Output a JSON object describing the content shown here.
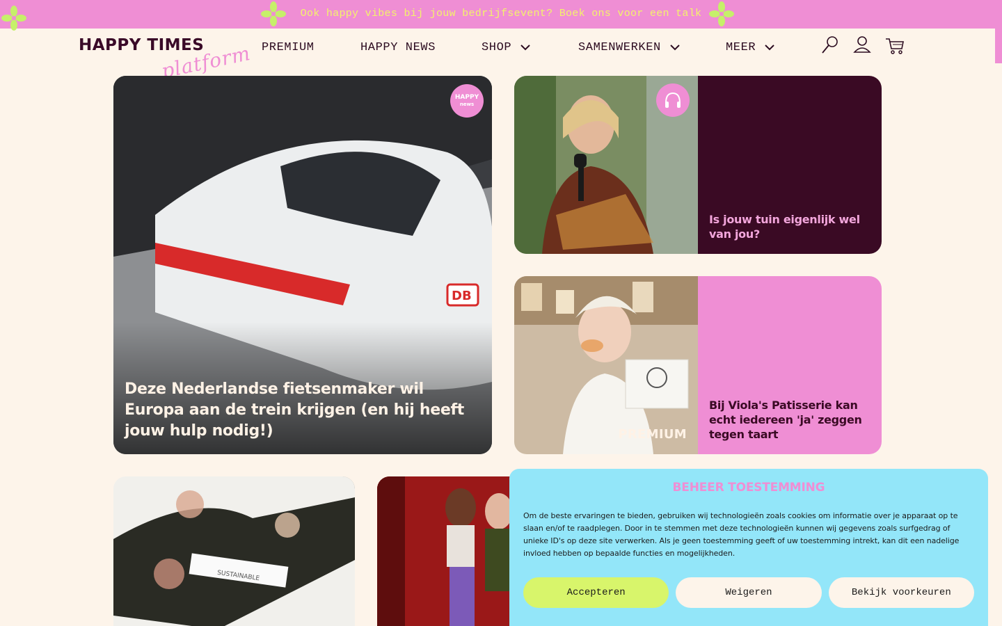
{
  "announcement": {
    "text": "Ook happy vibes bij jouw bedrijfsevent? Boek ons voor een talk"
  },
  "logo": {
    "main": "HAPPY TIMES",
    "script": "platform"
  },
  "nav": {
    "items": [
      {
        "label": "PREMIUM",
        "dropdown": false
      },
      {
        "label": "HAPPY NEWS",
        "dropdown": false
      },
      {
        "label": "SHOP",
        "dropdown": true
      },
      {
        "label": "SAMENWERKEN",
        "dropdown": true
      },
      {
        "label": "MEER",
        "dropdown": true
      }
    ],
    "icons": [
      "search-icon",
      "account-icon",
      "cart-icon"
    ]
  },
  "cards": {
    "featured": {
      "title": "Deze Nederlandse fietsenmaker wil Europa aan de trein krijgen (en hij heeft jouw hulp nodig!)",
      "badge_top": "HAPPY",
      "badge_bottom": "news"
    },
    "podcast": {
      "title": "Is jouw tuin eigenlijk wel van jou?",
      "icon": "headphones-icon"
    },
    "patisserie": {
      "title": "Bij Viola's Patisserie kan echt iedereen 'ja' zeggen tegen taart",
      "tag": "PREMIUM"
    }
  },
  "consent": {
    "title": "BEHEER TOESTEMMING",
    "body": "Om de beste ervaringen te bieden, gebruiken wij technologieën zoals cookies om informatie over je apparaat op te slaan en/of te raadplegen. Door in te stemmen met deze technologieën kunnen wij gegevens zoals surfgedrag of unieke ID's op deze site verwerken. Als je geen toestemming geeft of uw toestemming intrekt, kan dit een nadelige invloed hebben op bepaalde functies en mogelijkheden.",
    "accept": "Accepteren",
    "deny": "Weigeren",
    "prefs": "Bekijk voorkeuren"
  },
  "colors": {
    "pink": "#ef8ed4",
    "lime": "#d8f56b",
    "cream": "#fdf4ea",
    "plum": "#3a0a24",
    "cyan": "#93e6f9"
  }
}
